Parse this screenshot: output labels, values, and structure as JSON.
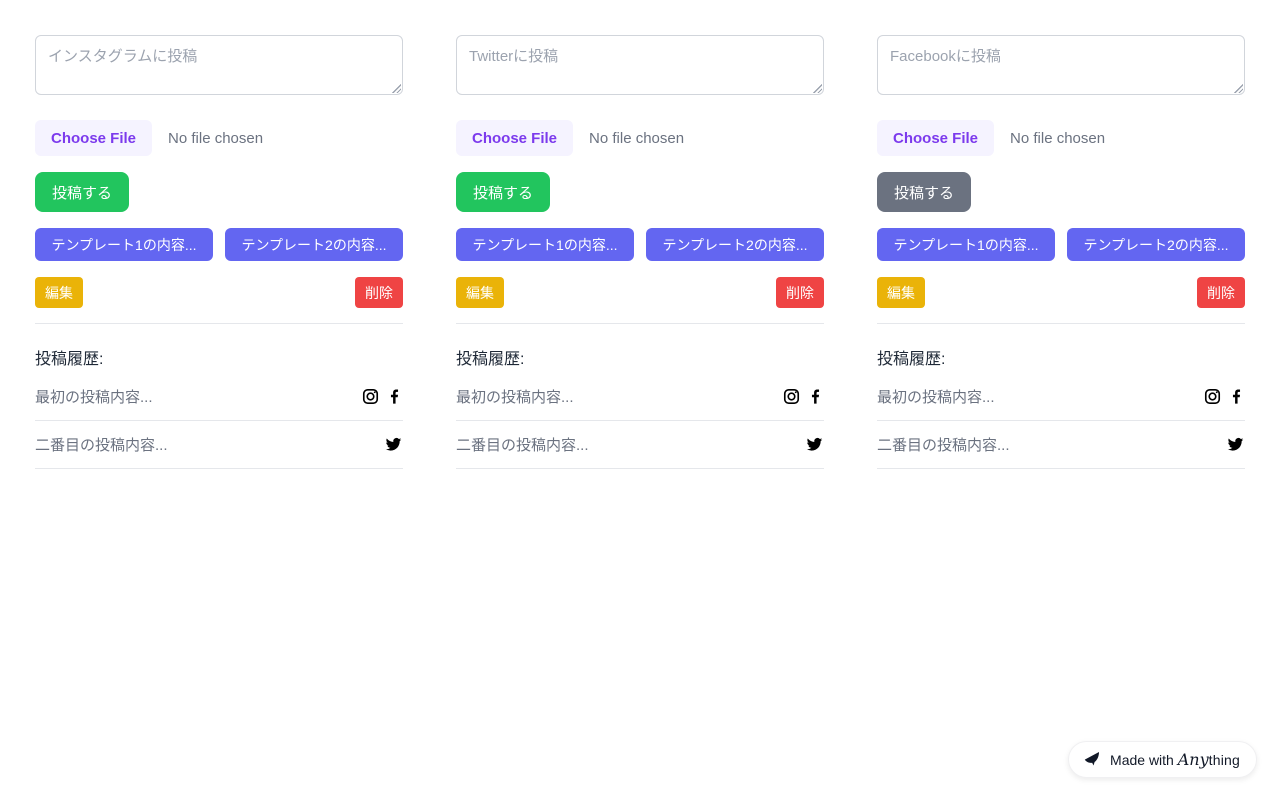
{
  "columns": [
    {
      "platform": "instagram",
      "textarea_placeholder": "インスタグラムに投稿",
      "file_button_label": "Choose File",
      "file_status": "No file chosen",
      "post_button_label": "投稿する",
      "post_button_state": "enabled",
      "templates": [
        {
          "label": "テンプレート1の内容..."
        },
        {
          "label": "テンプレート2の内容..."
        }
      ],
      "edit_label": "編集",
      "delete_label": "削除",
      "history_heading": "投稿履歴:",
      "history": [
        {
          "text": "最初の投稿内容...",
          "icons": [
            "instagram-icon",
            "facebook-icon"
          ]
        },
        {
          "text": "二番目の投稿内容...",
          "icons": [
            "twitter-icon"
          ]
        }
      ]
    },
    {
      "platform": "twitter",
      "textarea_placeholder": "Twitterに投稿",
      "file_button_label": "Choose File",
      "file_status": "No file chosen",
      "post_button_label": "投稿する",
      "post_button_state": "enabled",
      "templates": [
        {
          "label": "テンプレート1の内容..."
        },
        {
          "label": "テンプレート2の内容..."
        }
      ],
      "edit_label": "編集",
      "delete_label": "削除",
      "history_heading": "投稿履歴:",
      "history": [
        {
          "text": "最初の投稿内容...",
          "icons": [
            "instagram-icon",
            "facebook-icon"
          ]
        },
        {
          "text": "二番目の投稿内容...",
          "icons": [
            "twitter-icon"
          ]
        }
      ]
    },
    {
      "platform": "facebook",
      "textarea_placeholder": "Facebookに投稿",
      "file_button_label": "Choose File",
      "file_status": "No file chosen",
      "post_button_label": "投稿する",
      "post_button_state": "disabled",
      "templates": [
        {
          "label": "テンプレート1の内容..."
        },
        {
          "label": "テンプレート2の内容..."
        }
      ],
      "edit_label": "編集",
      "delete_label": "削除",
      "history_heading": "投稿履歴:",
      "history": [
        {
          "text": "最初の投稿内容...",
          "icons": [
            "instagram-icon",
            "facebook-icon"
          ]
        },
        {
          "text": "二番目の投稿内容...",
          "icons": [
            "twitter-icon"
          ]
        }
      ]
    }
  ],
  "colors": {
    "post_enabled": "#22c55e",
    "post_disabled": "#6b7280",
    "template": "#6366f1",
    "edit": "#eab308",
    "delete": "#ef4444",
    "file_button_bg": "#f5f3ff",
    "file_button_text": "#7c3aed",
    "divider": "#e5e7eb",
    "muted_text": "#6b7280"
  },
  "badge": {
    "made_with": "Made with",
    "brand_any": "Any",
    "brand_thing": "thing"
  }
}
